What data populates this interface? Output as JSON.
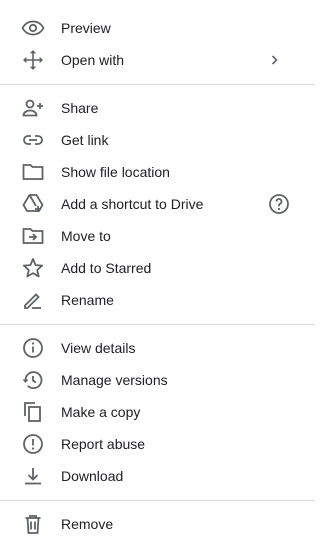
{
  "menu": {
    "groups": [
      {
        "items": [
          {
            "label": "Preview",
            "icon": "eye-icon"
          },
          {
            "label": "Open with",
            "icon": "move-arrows-icon",
            "trailing": "chevron-right-icon"
          }
        ]
      },
      {
        "items": [
          {
            "label": "Share",
            "icon": "person-add-icon"
          },
          {
            "label": "Get link",
            "icon": "link-icon"
          },
          {
            "label": "Show file location",
            "icon": "folder-icon"
          },
          {
            "label": "Add a shortcut to Drive",
            "icon": "drive-shortcut-icon",
            "trailing": "help-circle-icon"
          },
          {
            "label": "Move to",
            "icon": "folder-move-icon"
          },
          {
            "label": "Add to Starred",
            "icon": "star-outline-icon"
          },
          {
            "label": "Rename",
            "icon": "pencil-icon"
          }
        ]
      },
      {
        "items": [
          {
            "label": "View details",
            "icon": "info-icon"
          },
          {
            "label": "Manage versions",
            "icon": "history-icon"
          },
          {
            "label": "Make a copy",
            "icon": "copy-icon"
          },
          {
            "label": "Report abuse",
            "icon": "report-icon"
          },
          {
            "label": "Download",
            "icon": "download-icon"
          }
        ]
      },
      {
        "items": [
          {
            "label": "Remove",
            "icon": "trash-icon"
          }
        ]
      }
    ],
    "colors": {
      "icon": "#5f6368",
      "text": "#202124",
      "divider": "#dadce0"
    }
  }
}
